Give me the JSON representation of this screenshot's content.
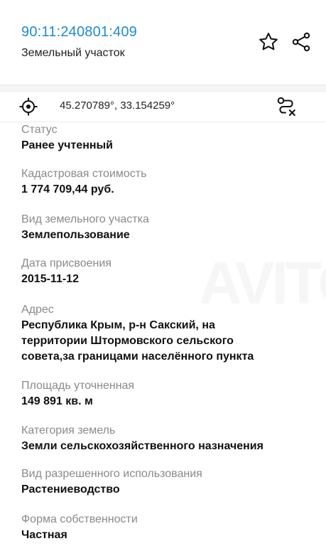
{
  "header": {
    "cadastral_number": "90:11:240801:409",
    "plot_type": "Земельный участок",
    "icons": {
      "favorite": "star-icon",
      "share": "share-icon"
    }
  },
  "coords_bar": {
    "coordinates": "45.270789°, 33.154259°",
    "icons": {
      "location": "target-icon",
      "route": "route-close-icon"
    }
  },
  "properties": [
    {
      "label": "Статус",
      "value": "Ранее учтенный"
    },
    {
      "label": "Кадастровая стоимость",
      "value": "1 774 709,44 руб."
    },
    {
      "label": "Вид земельного участка",
      "value": "Землепользование"
    },
    {
      "label": "Дата присвоения",
      "value": "2015-11-12"
    },
    {
      "label": "Адрес",
      "value_lines": [
        "Республика Крым, р-н Сакский, на",
        "территории Штормовского сельского",
        "совета,за границами населённого пункта"
      ]
    },
    {
      "label": "Площадь уточненная",
      "value": "149 891 кв. м"
    },
    {
      "label": "Категория земель",
      "value": "Земли сельскохозяйственного назначения"
    },
    {
      "label": "Вид разрешенного использования",
      "value": "Растениеводство"
    },
    {
      "label": "Форма собственности",
      "value": "Частная"
    }
  ],
  "colors": {
    "accent": "#1f8bd1",
    "label": "#8a8a8a",
    "value": "#111111"
  }
}
